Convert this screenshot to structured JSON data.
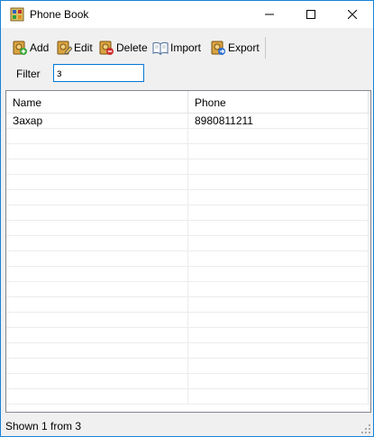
{
  "window": {
    "title": "Phone Book",
    "accent": "#1883d7"
  },
  "toolbar": {
    "add_label": "Add",
    "edit_label": "Edit",
    "delete_label": "Delete",
    "import_label": "Import",
    "export_label": "Export"
  },
  "filter": {
    "label": "Filter",
    "value": "з"
  },
  "grid": {
    "columns": [
      "Name",
      "Phone"
    ],
    "rows": [
      {
        "name": "Захар",
        "phone": "8980811211"
      }
    ]
  },
  "status": {
    "text": "Shown 1 from 3"
  },
  "icons": {
    "app": "phonebook-app-icon",
    "add": "book-add-icon",
    "edit": "book-edit-icon",
    "delete": "book-delete-icon",
    "import": "open-book-icon",
    "export": "book-export-icon"
  }
}
